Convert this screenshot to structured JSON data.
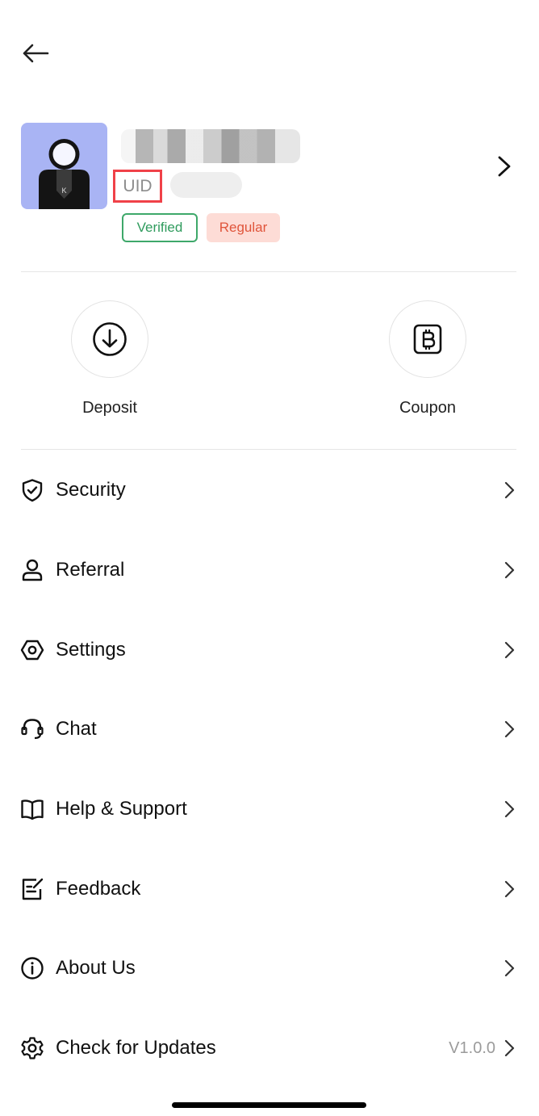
{
  "header": {
    "back_icon": "arrow-left-icon"
  },
  "profile": {
    "uid_label": "UID",
    "badges": {
      "verified": "Verified",
      "regular": "Regular"
    },
    "colors": {
      "avatar_bg": "#a9b4f4",
      "uid_highlight": "#f04148",
      "verified": "#2f9b5d",
      "regular": "#e0553b"
    }
  },
  "actions": [
    {
      "label": "Deposit",
      "icon": "download-circle-icon"
    },
    {
      "label": "Coupon",
      "icon": "bitcoin-card-icon"
    }
  ],
  "menu": [
    {
      "label": "Security",
      "icon": "shield-check-icon"
    },
    {
      "label": "Referral",
      "icon": "user-icon"
    },
    {
      "label": "Settings",
      "icon": "hexagon-settings-icon"
    },
    {
      "label": "Chat",
      "icon": "headset-icon"
    },
    {
      "label": "Help & Support",
      "icon": "book-icon"
    },
    {
      "label": "Feedback",
      "icon": "edit-note-icon"
    },
    {
      "label": "About Us",
      "icon": "info-icon"
    },
    {
      "label": "Check for Updates",
      "icon": "gear-icon",
      "value": "V1.0.0"
    }
  ]
}
